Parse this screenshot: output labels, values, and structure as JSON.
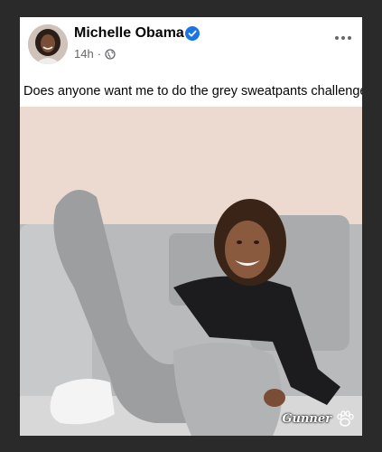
{
  "post": {
    "author": "Michelle Obama",
    "time": "14h",
    "separator": "·",
    "caption": "Does anyone want me to do the grey sweatpants challenge?",
    "icons": {
      "verified": "verified-badge-icon",
      "audience": "globe-icon",
      "more": "more-options-icon"
    }
  },
  "watermark": {
    "text": "Gunner"
  },
  "colors": {
    "frame": "#2a2a2a",
    "verified_blue": "#1b74e4",
    "text_primary": "#050505",
    "text_secondary": "#65676b"
  }
}
